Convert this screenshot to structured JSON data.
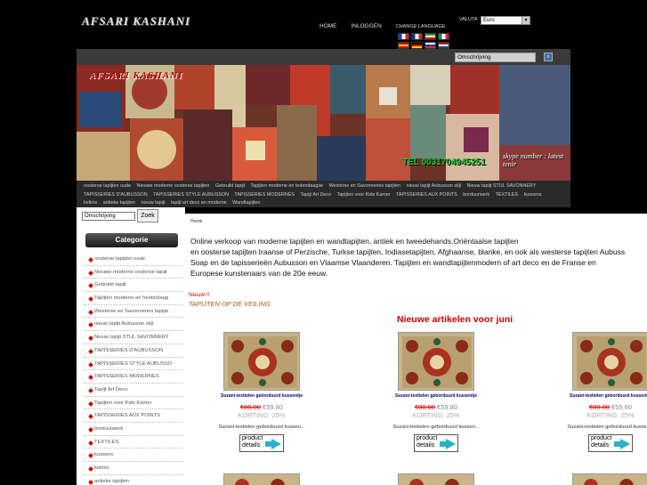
{
  "header": {
    "logo_text": "AFSARI KASHANI",
    "nav": [
      "HOME",
      "INLOGGEN",
      "CHANGE LANGUAGE"
    ],
    "valuta_label": "VALUTA",
    "valuta_value": "Euro",
    "flags": [
      {
        "name": "fr-flag",
        "colors": [
          "#1f3fa8",
          "#ffffff",
          "#d22"
        ]
      },
      {
        "name": "uk-flag",
        "colors": [
          "#1a2d7a",
          "#ffffff",
          "#d22"
        ]
      },
      {
        "name": "ir-flag",
        "colors": [
          "#239f40",
          "#ffffff",
          "#da0000"
        ]
      },
      {
        "name": "it-flag",
        "colors": [
          "#009246",
          "#ffffff",
          "#ce2b37"
        ]
      },
      {
        "name": "es-flag",
        "colors": [
          "#c60b1e",
          "#ffc400",
          "#c60b1e"
        ]
      },
      {
        "name": "de-flag",
        "colors": [
          "#000000",
          "#dd0000",
          "#ffce00"
        ]
      },
      {
        "name": "ru-flag",
        "colors": [
          "#ffffff",
          "#0039a6",
          "#d52b1e"
        ]
      },
      {
        "name": "nl-flag",
        "colors": [
          "#ae1c28",
          "#ffffff",
          "#21468b"
        ]
      }
    ]
  },
  "banner": {
    "search_value": "Omschrijving",
    "logo_text": "AFSARI KASHANI",
    "skype_text": "skype number :\n      latest tenir",
    "tel_text": "TEL 0031704945251"
  },
  "category_menu": [
    "oosterse tapijten oude",
    "Nieuwe moderne oosterse tapijten",
    "Gebruikt tapijt",
    "Tapijten moderne en tedendaagse",
    "Westerse en Savonneries tapijten",
    "nieuw tapijt Aubusson stijl",
    "Nieuw tapijt STUL SAVONNERY",
    "TAPISSERIES D'AUBUSSON",
    "TAPISSERIES STYLE AUBUSSON",
    "TAPISSERIES MODERNES",
    "Tapijt Art Deco",
    "Tapijten voor Kids Kamer",
    "TAPISSERIES AUX POINTS",
    "borduurwerk",
    "TEXTILES",
    "kussens",
    "kelims",
    "antieke tapijten",
    "nieuw tapijt",
    "tapijt art deco en moderne",
    "Wandtapijten"
  ],
  "left": {
    "search_value": "Omschrijving",
    "zoek_label": "Zoek",
    "category_heading": "Categorie",
    "categories": [
      "oosterse tapijten oude",
      "Nieuwe moderne oosterse tapijt",
      "Gebruikt tapijt",
      "Tapijten moderne en hedendaag",
      "Westerse en Savonneries tapijte",
      "nieuw tapijt Aubusson stijl",
      "Nieuw tapijt STUL SAVONNERY",
      "TAPISSERIES D'AUBUSSON",
      "TAPISSERIES STYLE AUBUSSO",
      "TAPISSERIES MODERNES",
      "Tapijt Art Deco",
      "Tapijten voor Kids Kamer",
      "TAPISSERIES AUX POINTS",
      "borduurwerk",
      "TEXTILES",
      "kussens",
      "kelims",
      "antieke tapijten"
    ]
  },
  "main": {
    "breadcrumb": "Home",
    "intro_lines": [
      "Online verkoop van moderne tapijten en wandtapijten, antiek en tweedehands.Oriëntaalse tapijten",
      "en oosterse tapijten Iraanse of Perzische, Turkse tapijten, Indiasetapijten, Afghaanse, blanke, en ook als westerse tapijten Aubuss",
      "Soap en de tapisserieën Aubusson en Vlaamse Vlaanderen. Tapijten en wandtapijtenmodern of art deco en de Franse en",
      "Europese kunstenaars van de 20e eeuw."
    ],
    "nieuw_label": "Nieuw  !!",
    "veiling_label": "TAPIJTEN OP DE VEILING",
    "new_title": "Nieuwe artikelen voor juni",
    "products": [
      {
        "name": "Suzani-textielen geborduurd kussentje",
        "old_price": "€80.00",
        "new_price": "€59.80",
        "korting": "KORTING: 25%",
        "desc": "Suzani-textielen geborduurd kussen...",
        "details": "product details"
      },
      {
        "name": "Suzani-textielen geborduurd kussentje",
        "old_price": "€80.00",
        "new_price": "€59.80",
        "korting": "KORTING: 25%",
        "desc": "Suzani-textielen geborduurd kussen...",
        "details": "product details"
      },
      {
        "name": "Suzani-textielen geborduurd kussentje",
        "old_price": "€80.00",
        "new_price": "€59.80",
        "korting": "KORTING: 25%",
        "desc": "Suzani-textielen geborduurd kussen...",
        "details": "product details"
      }
    ]
  },
  "colors": {
    "accent_red": "#cc0000",
    "bullet_red": "#cc0000",
    "button_arrow": "#2ab0c8"
  }
}
